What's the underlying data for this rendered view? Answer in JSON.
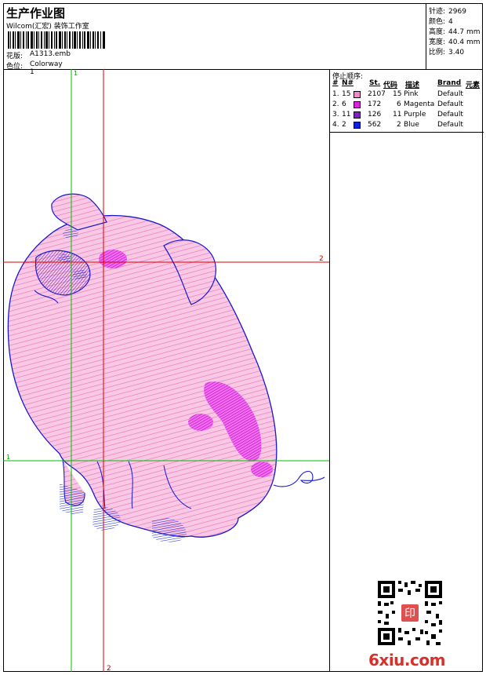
{
  "header": {
    "title": "生产作业图",
    "company": "Wilcom(汇宏) 装饰工作室",
    "pattern_label": "花版:",
    "pattern_value": "A1313.emb",
    "colorway_label": "色位:",
    "colorway_value": "Colorway 1"
  },
  "stats": [
    {
      "label": "针迹:",
      "value": "2969"
    },
    {
      "label": "颜色:",
      "value": "4"
    },
    {
      "label": "高度:",
      "value": "44.7 mm"
    },
    {
      "label": "宽度:",
      "value": "40.4 mm"
    },
    {
      "label": "比例:",
      "value": "3.40"
    }
  ],
  "stop_sequence": {
    "title": "停止顺序:",
    "columns": [
      "#",
      "N#",
      "St.",
      "代码",
      "描述",
      "Brand",
      "元素"
    ],
    "rows": [
      {
        "idx": "1.",
        "n": "15",
        "st": "2107",
        "code": "15",
        "desc": "Pink",
        "brand": "Default",
        "color": "#f08cc8"
      },
      {
        "idx": "2.",
        "n": "6",
        "st": "172",
        "code": "6",
        "desc": "Magenta",
        "brand": "Default",
        "color": "#e020e0"
      },
      {
        "idx": "3.",
        "n": "11",
        "st": "126",
        "code": "11",
        "desc": "Purple",
        "brand": "Default",
        "color": "#8020c0"
      },
      {
        "idx": "4.",
        "n": "2",
        "st": "562",
        "code": "2",
        "desc": "Blue",
        "brand": "Default",
        "color": "#1020e0"
      }
    ]
  },
  "guides": {
    "v1_label": "1",
    "v2_label": "2",
    "h1_label": "1",
    "h2_label": "2",
    "v2_bottom_label": "2"
  },
  "watermark": {
    "site": "6xiu.com",
    "site_color": "#d8302a",
    "stamp_text": "印"
  },
  "colors": {
    "green_guide": "#00c000",
    "red_guide": "#e00000",
    "outline": "#1818d0"
  }
}
